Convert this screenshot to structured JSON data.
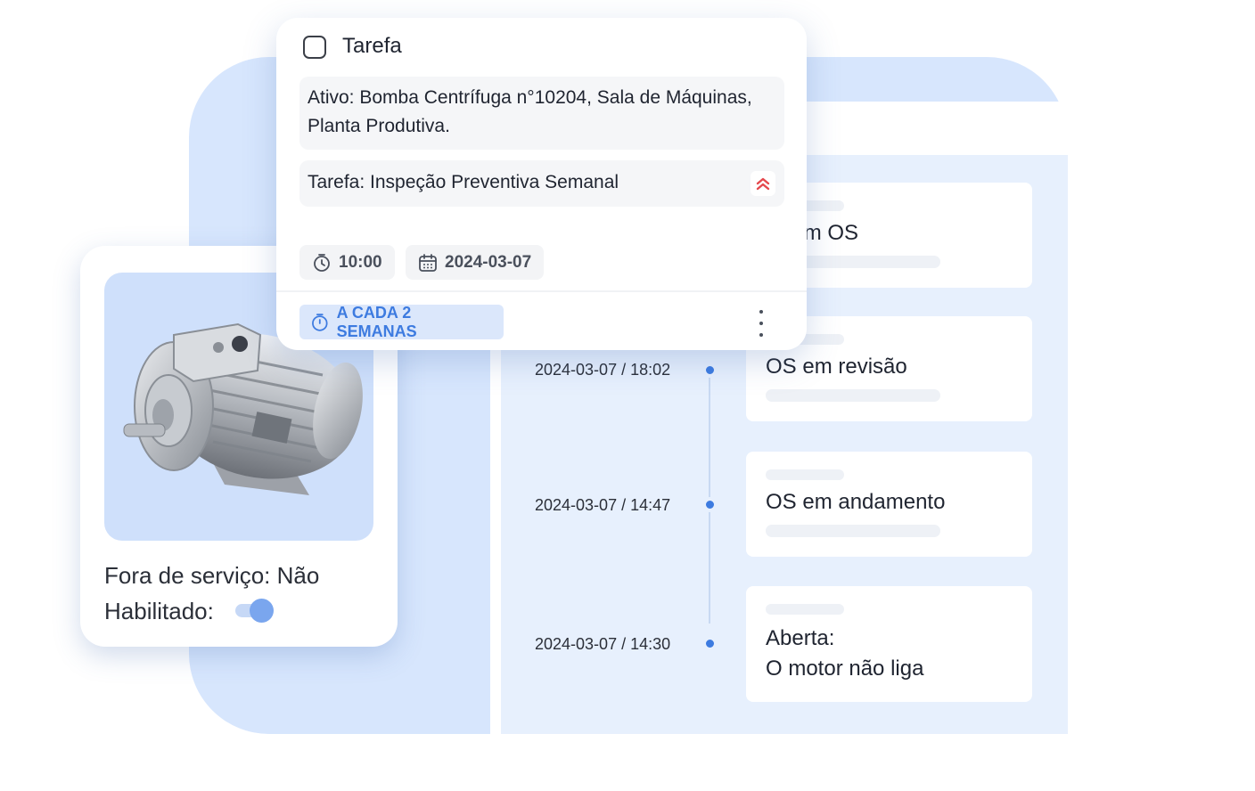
{
  "task_card": {
    "title": "Tarefa",
    "asset_label": "Ativo:",
    "asset_value": " Bomba Centrífuga n°10204, Sala de Máquinas, Planta Produtiva.",
    "task_text": "Tarefa: Inspeção Preventiva Semanal",
    "priority_icon": "double-chevron-up-icon",
    "priority_color": "#e5484d",
    "time": "10:00",
    "date": "2024-03-07",
    "recurrence": "A CADA 2 SEMANAS",
    "accent_color": "#3d7be0"
  },
  "equipment": {
    "out_of_service": "Fora de serviço: Não",
    "enabled_label": "Habilitado:",
    "enabled": true
  },
  "timeline": {
    "items": [
      {
        "status": "olvido com OS"
      },
      {
        "date": "2024-03-07 / 18:02",
        "status": "OS em revisão"
      },
      {
        "date": "2024-03-07 / 14:47",
        "status": "OS em andamento"
      },
      {
        "date": "2024-03-07 / 14:30",
        "status_line1": "Aberta:",
        "status_line2": "O motor não liga"
      }
    ]
  }
}
